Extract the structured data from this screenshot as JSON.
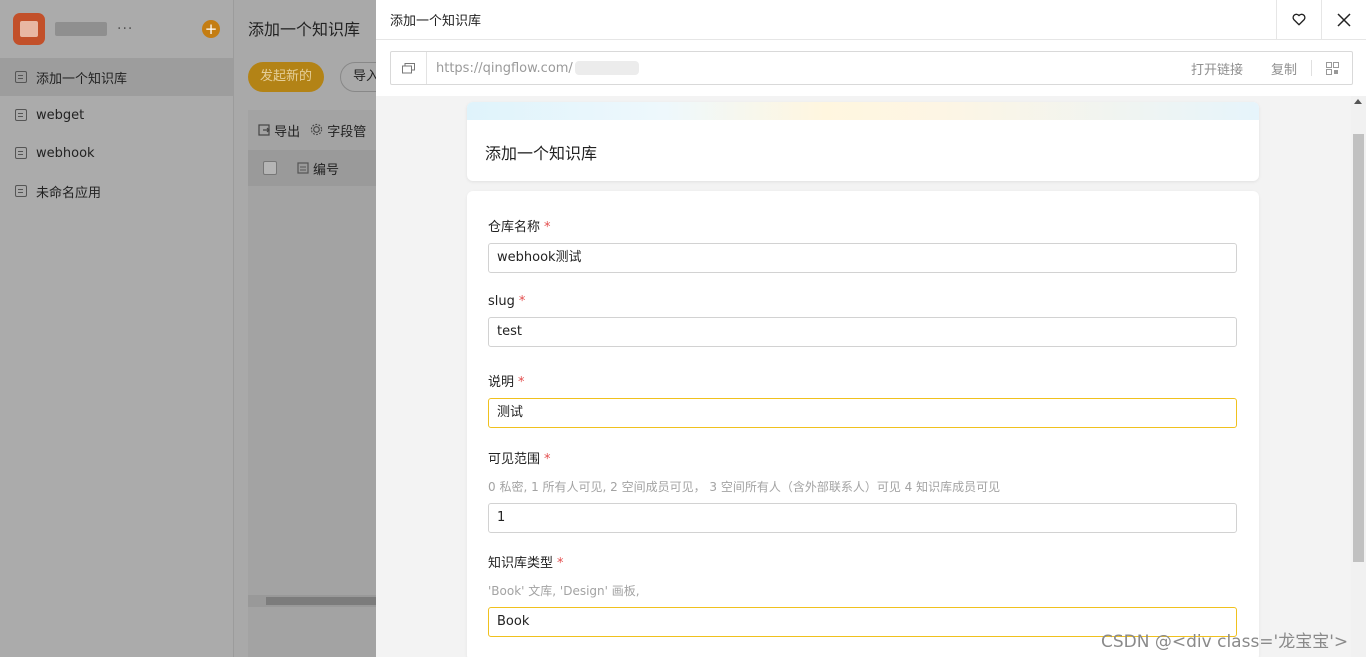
{
  "sidebar": {
    "more": "···",
    "add": "+",
    "items": [
      {
        "label": "添加一个知识库"
      },
      {
        "label": "webget"
      },
      {
        "label": "webhook"
      },
      {
        "label": "未命名应用"
      }
    ]
  },
  "main": {
    "title": "添加一个知识库",
    "start_button": "发起新的",
    "import_button": "导入",
    "export_label": "导出",
    "fields_label": "字段管",
    "col_number": "编号"
  },
  "drawer": {
    "title": "添加一个知识库",
    "url": "https://qingflow.com/",
    "open_link": "打开链接",
    "copy": "复制",
    "form_title": "添加一个知识库",
    "fields": [
      {
        "label": "仓库名称",
        "required": "*",
        "hint": "",
        "value": "webhook测试"
      },
      {
        "label": "slug",
        "required": "*",
        "hint": "",
        "value": "test"
      },
      {
        "label": "说明",
        "required": "*",
        "hint": "",
        "value": "测试"
      },
      {
        "label": "可见范围",
        "required": "*",
        "hint": "0 私密, 1 所有人可见, 2 空间成员可见， 3 空间所有人（含外部联系人）可见 4 知识库成员可见",
        "value": "1"
      },
      {
        "label": "知识库类型",
        "required": "*",
        "hint": "'Book' 文库, 'Design' 画板,",
        "value": "Book"
      }
    ]
  },
  "watermark": "CSDN @<div class='龙宝宝'>",
  "colors": {
    "accent": "#f0c11e",
    "required": "#e34d4d"
  }
}
